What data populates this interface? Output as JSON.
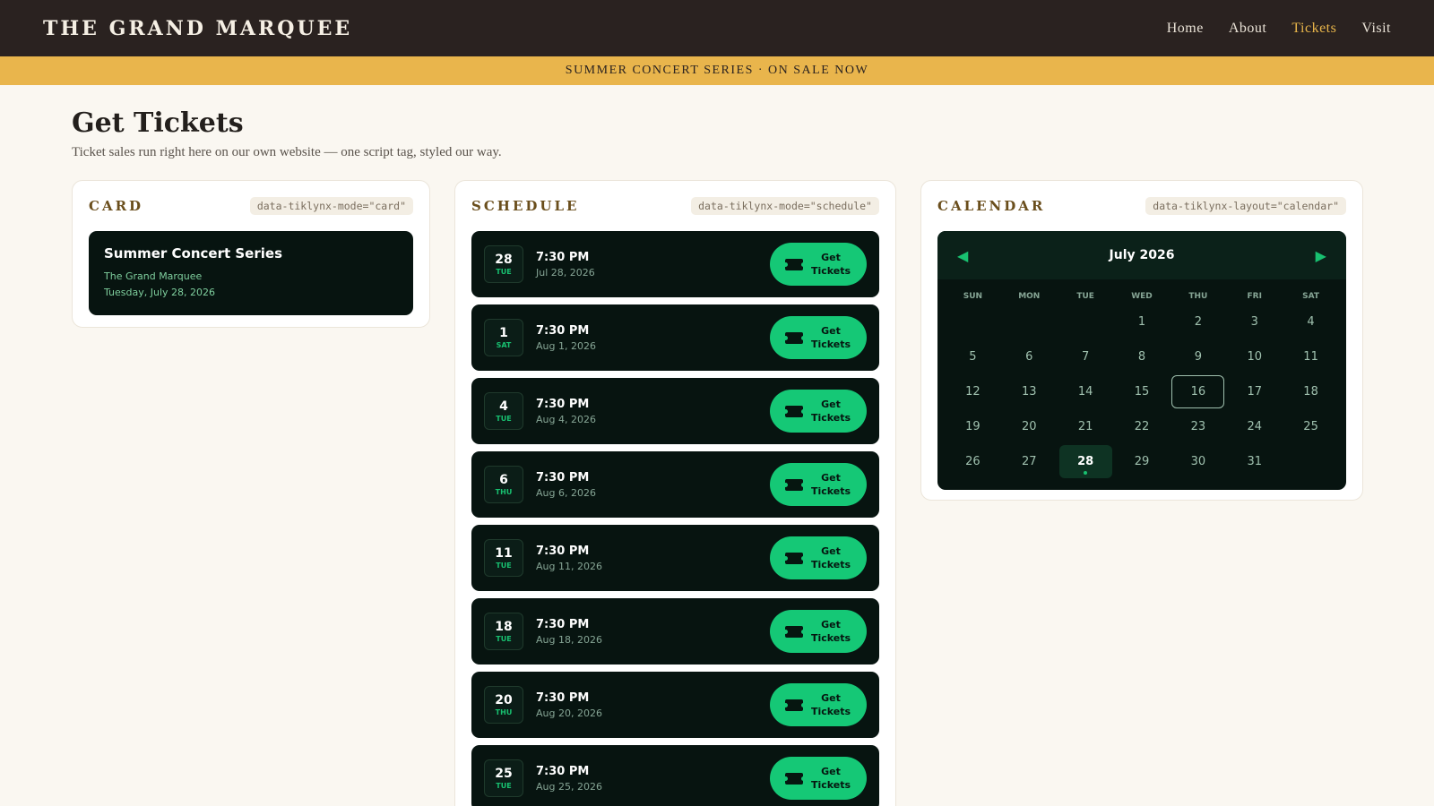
{
  "nav": {
    "brand": "THE GRAND MARQUEE",
    "links": [
      {
        "label": "Home",
        "active": false
      },
      {
        "label": "About",
        "active": false
      },
      {
        "label": "Tickets",
        "active": true
      },
      {
        "label": "Visit",
        "active": false
      }
    ]
  },
  "banner": "SUMMER CONCERT SERIES · ON SALE NOW",
  "page": {
    "title": "Get Tickets",
    "subtitle": "Ticket sales run right here on our own website — one script tag, styled our way."
  },
  "card_panel": {
    "title": "CARD",
    "code": "data-tiklynx-mode=\"card\"",
    "event": {
      "title": "Summer Concert Series",
      "venue": "The Grand Marquee",
      "date": "Tuesday, July 28, 2026"
    }
  },
  "schedule_panel": {
    "title": "SCHEDULE",
    "code": "data-tiklynx-mode=\"schedule\"",
    "button_label": "Get Tickets",
    "events": [
      {
        "day": "28",
        "dow": "TUE",
        "time": "7:30 PM",
        "date": "Jul 28, 2026"
      },
      {
        "day": "1",
        "dow": "SAT",
        "time": "7:30 PM",
        "date": "Aug 1, 2026"
      },
      {
        "day": "4",
        "dow": "TUE",
        "time": "7:30 PM",
        "date": "Aug 4, 2026"
      },
      {
        "day": "6",
        "dow": "THU",
        "time": "7:30 PM",
        "date": "Aug 6, 2026"
      },
      {
        "day": "11",
        "dow": "TUE",
        "time": "7:30 PM",
        "date": "Aug 11, 2026"
      },
      {
        "day": "18",
        "dow": "TUE",
        "time": "7:30 PM",
        "date": "Aug 18, 2026"
      },
      {
        "day": "20",
        "dow": "THU",
        "time": "7:30 PM",
        "date": "Aug 20, 2026"
      },
      {
        "day": "25",
        "dow": "TUE",
        "time": "7:30 PM",
        "date": "Aug 25, 2026"
      }
    ]
  },
  "calendar_panel": {
    "title": "CALENDAR",
    "code": "data-tiklynx-layout=\"calendar\"",
    "month": "July 2026",
    "weekdays": [
      "SUN",
      "MON",
      "TUE",
      "WED",
      "THU",
      "FRI",
      "SAT"
    ],
    "first_weekday": 3,
    "days_in_month": 31,
    "today": 16,
    "selected": 28
  },
  "colors": {
    "accent_green": "#15c876",
    "gold": "#e9b54c",
    "dark_card": "#071410"
  }
}
